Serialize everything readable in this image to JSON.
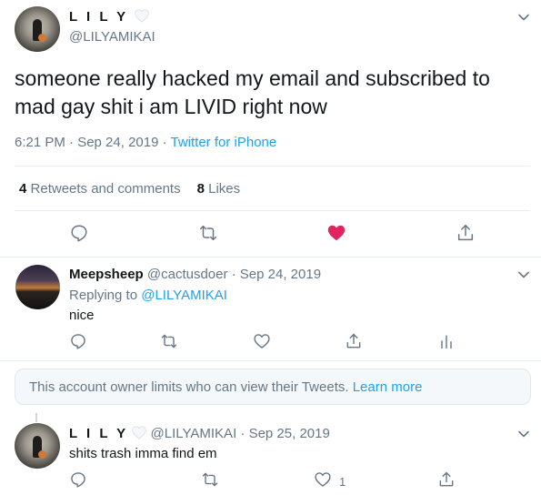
{
  "main_tweet": {
    "display_name": "L I L Y",
    "handle": "@LILYAMIKAI",
    "text": "someone really hacked my email and subscribed to mad gay shit i am LIVID right now",
    "time": "6:21 PM · Sep 24, 2019 · ",
    "source": "Twitter for iPhone",
    "retweets_count": "4",
    "retweets_label": "Retweets and comments",
    "likes_count": "8",
    "likes_label": "Likes",
    "liked": true,
    "icons": [
      "reply-icon",
      "retweet-icon",
      "heart-filled-icon",
      "share-icon"
    ],
    "like_color": "#e0245e"
  },
  "reply": {
    "display_name": "Meepsheep",
    "meta": "@cactusdoer · Sep 24, 2019",
    "replying_prefix": "Replying to ",
    "replying_to": "@LILYAMIKAI",
    "text": "nice"
  },
  "notice": {
    "text": "This account owner limits who can view their Tweets. ",
    "link": "Learn more"
  },
  "reply2": {
    "display_name": "L I L Y",
    "meta": "@LILYAMIKAI · Sep 25, 2019",
    "text": "shits trash imma find em",
    "like_count": "1"
  },
  "colors": {
    "accent": "#1da1f2",
    "secondary_text": "#657786",
    "divider": "#e6ecf0"
  }
}
